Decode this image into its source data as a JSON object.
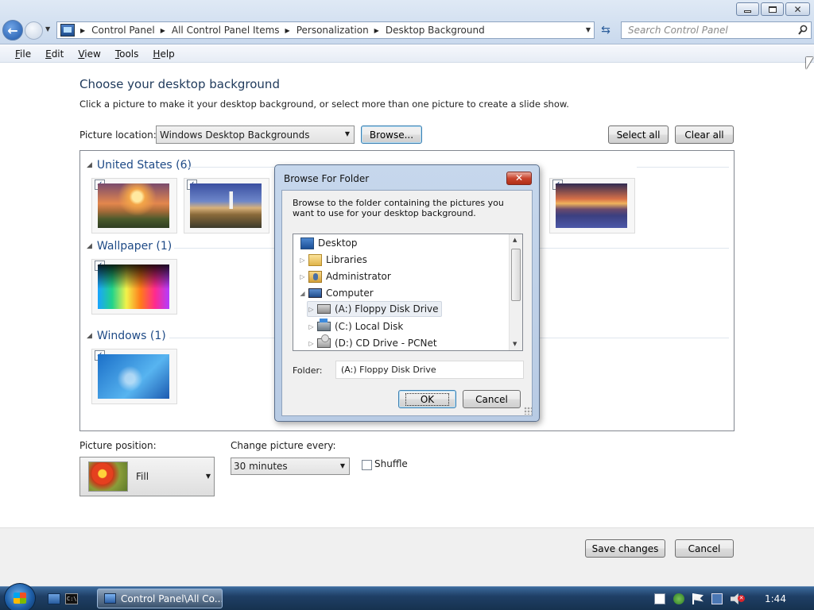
{
  "window": {
    "breadcrumbs": [
      "Control Panel",
      "All Control Panel Items",
      "Personalization",
      "Desktop Background"
    ],
    "search_placeholder": "Search Control Panel"
  },
  "menu": [
    "File",
    "Edit",
    "View",
    "Tools",
    "Help"
  ],
  "page": {
    "heading": "Choose your desktop background",
    "subheading": "Click a picture to make it your desktop background, or select more than one picture to create a slide show.",
    "picture_location_label": "Picture location:",
    "picture_location_value": "Windows Desktop Backgrounds",
    "browse_label": "Browse...",
    "select_all_label": "Select all",
    "clear_all_label": "Clear all"
  },
  "gallery": {
    "groups": [
      {
        "label": "United States (6)"
      },
      {
        "label": "Wallpaper (1)"
      },
      {
        "label": "Windows (1)"
      }
    ]
  },
  "options": {
    "position_label": "Picture position:",
    "position_value": "Fill",
    "change_label": "Change picture every:",
    "change_value": "30 minutes",
    "shuffle_label": "Shuffle",
    "shuffle_checked": false
  },
  "footer": {
    "save_label": "Save changes",
    "cancel_label": "Cancel"
  },
  "dialog": {
    "title": "Browse For Folder",
    "instructions": "Browse to the folder containing the pictures you want to use for your desktop background.",
    "tree": [
      {
        "label": "Desktop",
        "icon": "desktop-icon"
      },
      {
        "label": "Libraries",
        "icon": "libraries-icon"
      },
      {
        "label": "Administrator",
        "icon": "user-folder-icon"
      },
      {
        "label": "Computer",
        "icon": "computer-icon"
      },
      {
        "label": "(A:) Floppy Disk Drive",
        "icon": "floppy-drive-icon",
        "selected": true
      },
      {
        "label": "(C:) Local Disk",
        "icon": "local-disk-icon"
      },
      {
        "label": "(D:) CD Drive - PCNet",
        "icon": "cd-drive-icon"
      }
    ],
    "folder_label": "Folder:",
    "folder_value": "(A:) Floppy Disk Drive",
    "ok_label": "OK",
    "cancel_label": "Cancel"
  },
  "taskbar": {
    "task_label": "Control Panel\\All Co...",
    "clock": "1:44"
  }
}
